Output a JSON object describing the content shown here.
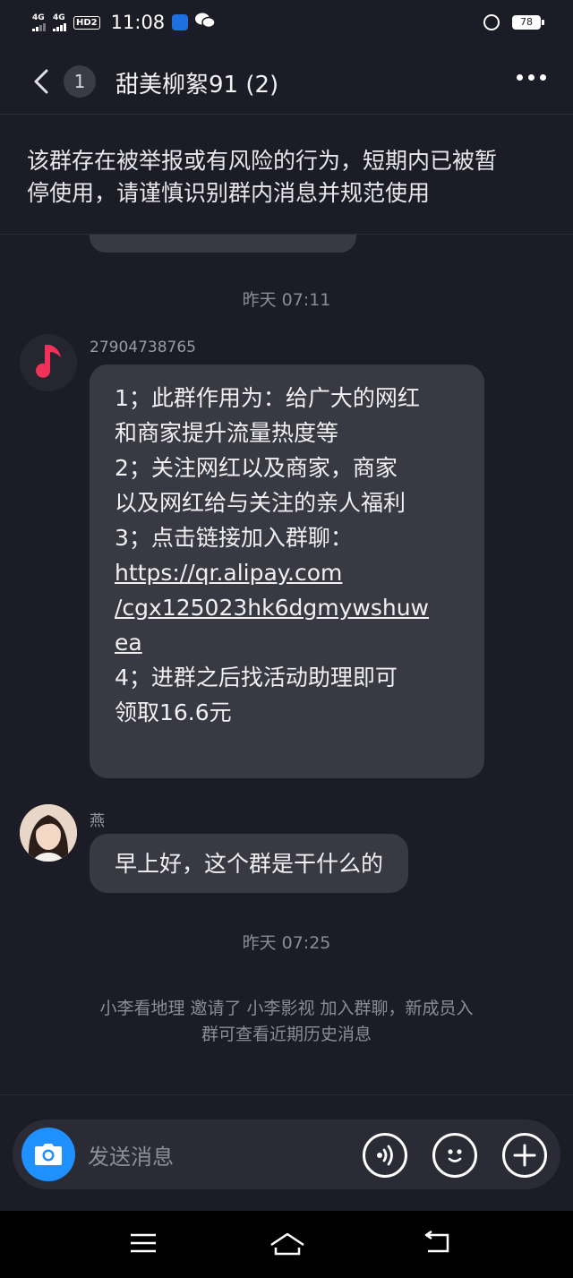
{
  "status_bar": {
    "signal1": "4G",
    "signal2": "4G",
    "hd": "HD2",
    "time": "11:08",
    "battery": "78",
    "colors": {
      "app1": "#1e6fe0",
      "app2": "#ffffff"
    }
  },
  "header": {
    "unread_count": "1",
    "title": "甜美柳絮91 (2)"
  },
  "warning_banner": {
    "text_line1": "该群存在被举报或有风险的行为，短期内已被暂",
    "text_line2": "停使用，请谨慎识别群内消息并规范使用"
  },
  "messages": [
    {
      "type": "time",
      "text": "昨天 07:11"
    },
    {
      "type": "message",
      "sender": "27904738765",
      "avatar_icon": "music-note-icon",
      "lines": [
        "1；此群作用为：给广大的网红",
        "和商家提升流量热度等",
        "2；关注网红以及商家，商家",
        "以及网红给与关注的亲人福利",
        "3；点击链接加入群聊：",
        "https://qr.alipay.com",
        "/cgx125023hk6dgmywshuw",
        "ea",
        "4；进群之后找活动助理即可",
        "领取16.6元"
      ]
    },
    {
      "type": "message",
      "sender": "燕",
      "avatar_icon": "user-photo-avatar",
      "text": "早上好，这个群是干什么的"
    },
    {
      "type": "time",
      "text": "昨天 07:25"
    },
    {
      "type": "system",
      "line1": "小李看地理 邀请了 小李影视 加入群聊，新成员入",
      "line2": "群可查看近期历史消息"
    }
  ],
  "input_bar": {
    "placeholder": "发送消息",
    "icons": [
      "camera-icon",
      "voice-icon",
      "emoji-icon",
      "plus-icon"
    ]
  },
  "nav_bar": {
    "icons": [
      "menu-icon",
      "home-icon",
      "back-icon"
    ]
  },
  "colors": {
    "background": "#1b1c25",
    "bubble": "#383942",
    "accent_blue": "#1e90ff",
    "music_red": "#f0325a"
  }
}
